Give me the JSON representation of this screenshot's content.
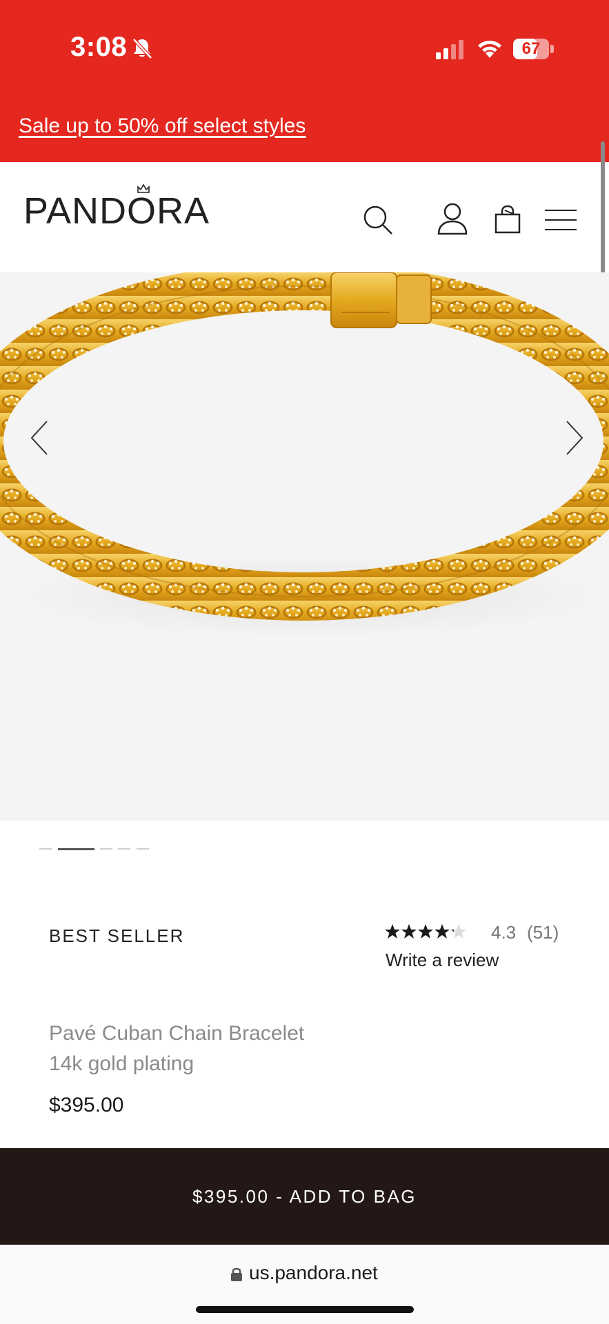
{
  "status_bar": {
    "time": "3:08",
    "battery": "67",
    "icons": [
      "bell-slash-icon",
      "cellular-signal-icon",
      "wifi-icon",
      "battery-icon"
    ]
  },
  "promo": {
    "text": "Sale up to 50% off select styles",
    "background_color": "#e4271f"
  },
  "header": {
    "logo": "PANDORA",
    "icons": [
      "search-icon",
      "account-icon",
      "shopping-bag-icon",
      "menu-icon"
    ]
  },
  "gallery": {
    "image_description_icon": "gold-cuban-chain-bracelet-image",
    "image_count": 5,
    "active_index": 1
  },
  "product": {
    "badge": "BEST SELLER",
    "rating": "4.3",
    "rating_value": 4.3,
    "review_count": "(51)",
    "write_review": "Write a review",
    "name": "Pavé Cuban Chain Bracelet",
    "material": "14k gold plating",
    "price": "$395.00"
  },
  "cta": {
    "label": "$395.00 - ADD TO BAG",
    "background_color": "#231815"
  },
  "browser": {
    "url": "us.pandora.net"
  }
}
